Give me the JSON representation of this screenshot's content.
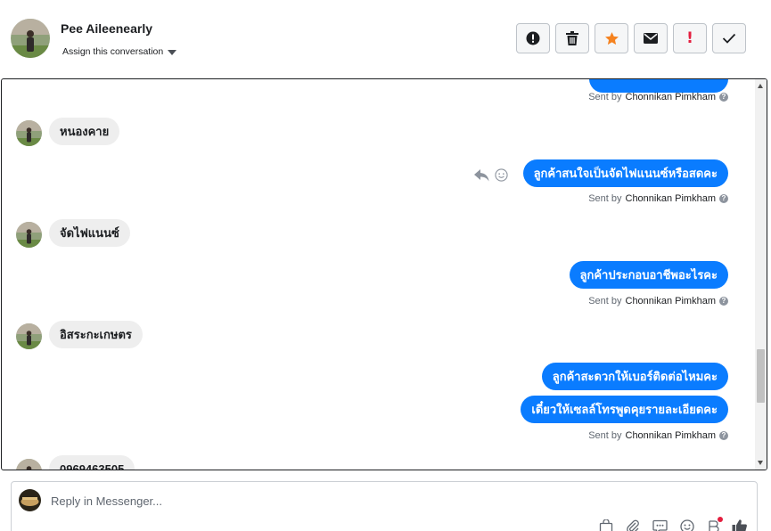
{
  "header": {
    "contact_name": "Pee Aileenearly",
    "assign_label": "Assign this conversation",
    "toolbar": [
      {
        "icon": "alert-circle-icon"
      },
      {
        "icon": "trash-icon"
      },
      {
        "icon": "star-icon",
        "color": "#f5821f"
      },
      {
        "icon": "envelope-icon"
      },
      {
        "icon": "exclamation-icon",
        "label": "!",
        "color": "#e41e3f"
      },
      {
        "icon": "check-icon"
      }
    ]
  },
  "thread": {
    "sent_by_prefix": "Sent by",
    "agent_name": "Chonnikan Pimkham",
    "messages": [
      {
        "dir": "in",
        "text": "หนองคาย"
      },
      {
        "dir": "out",
        "text": "ลูกค้าสนใจเป็นจัดไฟแนนซ์หรือสดคะ"
      },
      {
        "dir": "in",
        "text": "จัดไฟแนนซ์"
      },
      {
        "dir": "out",
        "text": "ลูกค้าประกอบอาชีพอะไรคะ"
      },
      {
        "dir": "in",
        "text": "อิสระกะเกษตร"
      },
      {
        "dir": "out",
        "text": "ลูกค้าสะดวกให้เบอร์ติดต่อไหมคะ"
      },
      {
        "dir": "out",
        "text": "เดี๋ยวให้เซลล์โทรพูดคุยรายละเอียดคะ"
      },
      {
        "dir": "in",
        "text": "0969463505"
      }
    ],
    "brand_blue": "#0a7cff"
  },
  "composer": {
    "placeholder": "Reply in Messenger...",
    "icons": [
      "bag-icon",
      "paperclip-icon",
      "saved-reply-icon",
      "emoji-icon",
      "appointment-icon",
      "like-icon"
    ]
  }
}
